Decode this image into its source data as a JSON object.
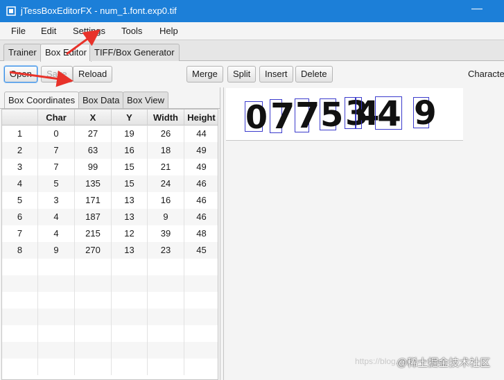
{
  "window": {
    "title": "jTessBoxEditorFX - num_1.font.exp0.tif",
    "minimize": "—"
  },
  "menu": [
    "File",
    "Edit",
    "Settings",
    "Tools",
    "Help"
  ],
  "main_tabs": [
    "Trainer",
    "Box Editor",
    "TIFF/Box Generator"
  ],
  "toolbar": {
    "open": "Open",
    "save": "Save",
    "reload": "Reload",
    "merge": "Merge",
    "split": "Split",
    "insert": "Insert",
    "delete": "Delete",
    "character_label": "Character"
  },
  "sub_tabs": [
    "Box Coordinates",
    "Box Data",
    "Box View"
  ],
  "table": {
    "columns": [
      "",
      "Char",
      "X",
      "Y",
      "Width",
      "Height"
    ],
    "rows": [
      [
        "1",
        "0",
        "27",
        "19",
        "26",
        "44"
      ],
      [
        "2",
        "7",
        "63",
        "16",
        "18",
        "49"
      ],
      [
        "3",
        "7",
        "99",
        "15",
        "21",
        "49"
      ],
      [
        "4",
        "5",
        "135",
        "15",
        "24",
        "46"
      ],
      [
        "5",
        "3",
        "171",
        "13",
        "16",
        "46"
      ],
      [
        "6",
        "4",
        "187",
        "13",
        "9",
        "46"
      ],
      [
        "7",
        "4",
        "215",
        "12",
        "39",
        "48"
      ],
      [
        "8",
        "9",
        "270",
        "13",
        "23",
        "45"
      ]
    ]
  },
  "image": {
    "digits": [
      "0",
      "7",
      "7",
      "5",
      "3",
      "4",
      "4",
      "9"
    ]
  },
  "watermark": {
    "faint": "https://blog.csdn.net/Kel",
    "main": "@稀土掘金技术社区"
  },
  "colors": {
    "titlebar": "#1c7fd8",
    "box_outline": "#3a3acc",
    "annotation_arrow": "#e8322a"
  }
}
